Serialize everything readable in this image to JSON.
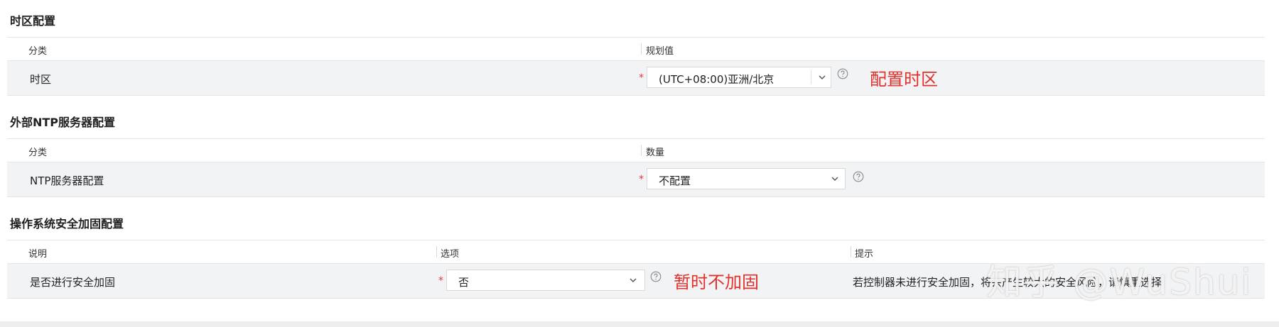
{
  "sections": {
    "timezone": {
      "title": "时区配置",
      "columns": [
        "分类",
        "规划值"
      ],
      "row": {
        "label": "时区",
        "required_mark": "*",
        "select_value": "(UTC+08:00)亚洲/北京"
      },
      "annotation": "配置时区"
    },
    "ntp": {
      "title": "外部NTP服务器配置",
      "columns": [
        "分类",
        "数量"
      ],
      "row": {
        "label": "NTP服务器配置",
        "required_mark": "*",
        "select_value": "不配置"
      }
    },
    "security": {
      "title": "操作系统安全加固配置",
      "columns": [
        "说明",
        "选项",
        "提示"
      ],
      "row": {
        "label": "是否进行安全加固",
        "required_mark": "*",
        "select_value": "否",
        "hint": "若控制器未进行安全加固，将会产生较大的安全风险，请慎重选择"
      },
      "annotation": "暂时不加固"
    }
  },
  "watermark": "知乎 @WuShui",
  "icons": {
    "dropdown": "chevron-down-icon",
    "help": "help-circle-icon"
  },
  "colors": {
    "annotation": "#e0322c",
    "required": "#e03b3b",
    "row_bg": "#f2f3f5"
  }
}
